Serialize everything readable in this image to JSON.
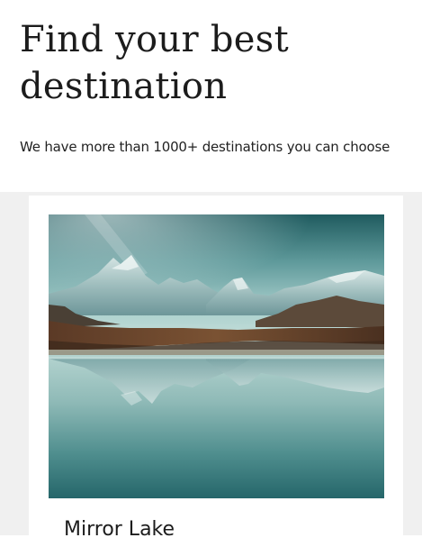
{
  "hero": {
    "title": "Find your best destination",
    "subtitle": "We have more than 1000+ destinations you can choose"
  },
  "destinations": [
    {
      "name": "Mirror Lake",
      "image": "mountain-lake-reflection-photo"
    }
  ],
  "colors": {
    "page_background": "#ffffff",
    "section_background": "#f0f0f0",
    "card_background": "#ffffff",
    "text": "#1c1c1c"
  }
}
